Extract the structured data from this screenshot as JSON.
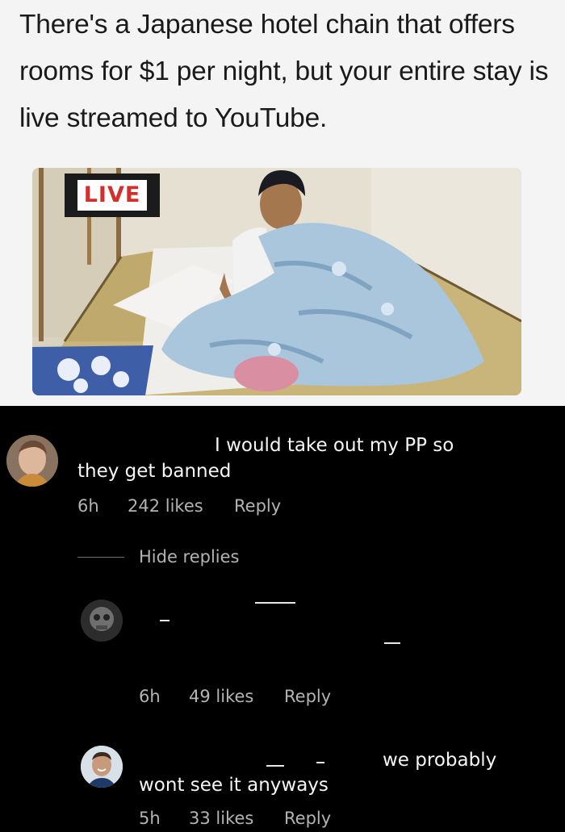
{
  "post": {
    "headline": "There's a Japanese hotel chain that offers rooms for $1 per night, but your entire stay is live streamed to YouTube.",
    "badge": "LIVE"
  },
  "comments": [
    {
      "text_line1": "I would take out my PP so",
      "text_line2": "they get banned",
      "time": "6h",
      "likes": "242 likes",
      "reply": "Reply",
      "hide_replies": "Hide replies"
    },
    {
      "time": "6h",
      "likes": "49 likes",
      "reply": "Reply"
    },
    {
      "text_line1": "we probably",
      "text_line2": "wont see it anyways",
      "time": "5h",
      "likes": "33 likes",
      "reply": "Reply"
    }
  ],
  "colors": {
    "background": "#000000",
    "header_bg": "#f4f4f4",
    "live_red": "#d0312d",
    "meta_gray": "#b3b3b3"
  }
}
